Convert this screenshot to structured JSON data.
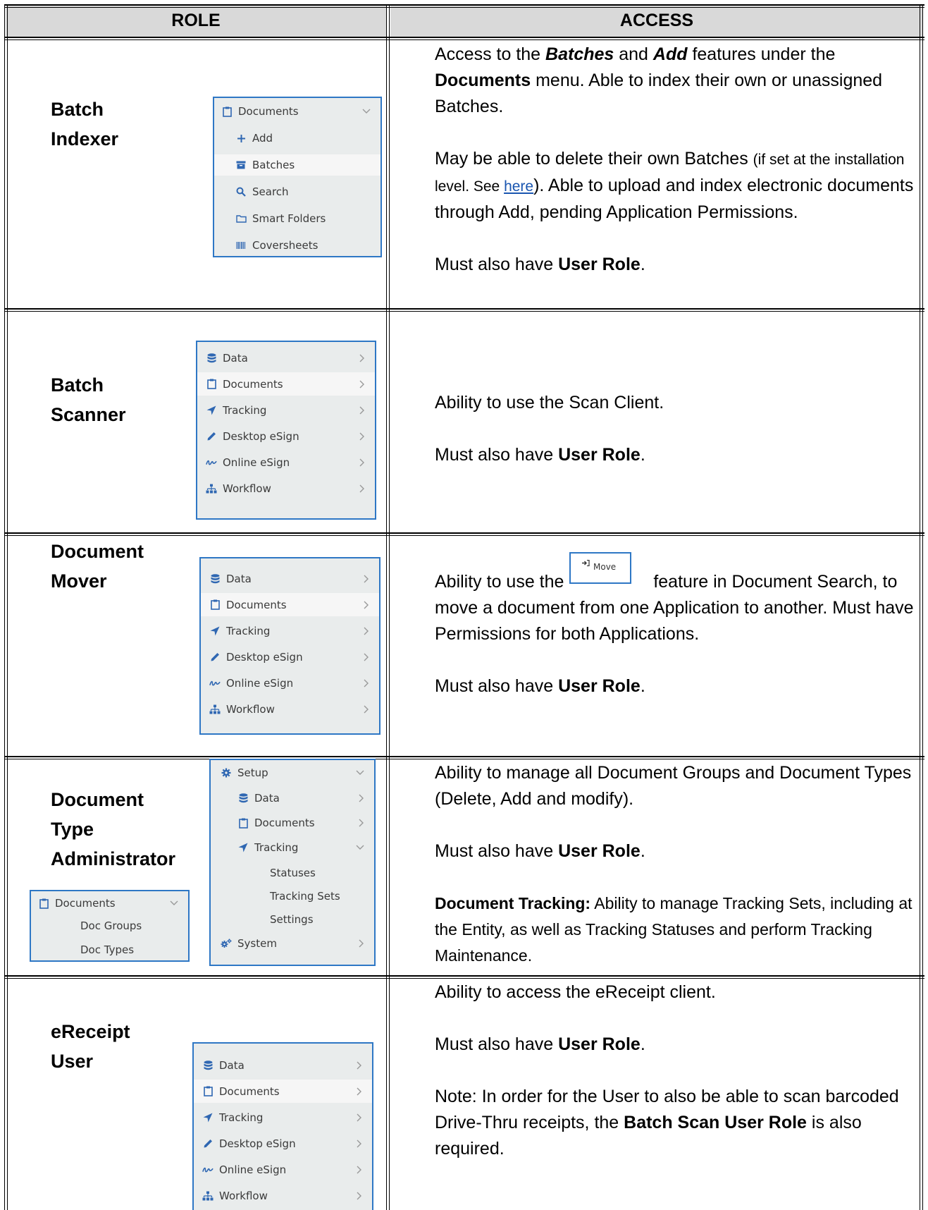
{
  "header": {
    "role": "ROLE",
    "access": "ACCESS"
  },
  "rows": [
    {
      "role_line1": "Batch",
      "role_line2": "Indexer",
      "menu": {
        "title": "Documents",
        "items": [
          "Add",
          "Batches",
          "Search",
          "Smart Folders",
          "Coversheets"
        ]
      },
      "access": {
        "p1_a": "Access to the ",
        "p1_b": "Batches",
        "p1_c": " and ",
        "p1_d": "Add",
        "p1_e": " features under the ",
        "p1_f": "Documents",
        "p1_g": " menu.  Able to index their own or unassigned Batches.",
        "p2_a": " May be able to delete their own Batches ",
        "p2_b": "(if set at the installation level.  See ",
        "p2_link": "here",
        "p2_c": ").  Able to upload and index electronic documents through Add, pending Application Permissions.",
        "p3_a": "Must also have ",
        "p3_b": "User Role",
        "p3_c": "."
      }
    },
    {
      "role_line1": "Batch",
      "role_line2": "Scanner",
      "menu": {
        "items": [
          "Data",
          "Documents",
          "Tracking",
          "Desktop eSign",
          "Online eSign",
          "Workflow"
        ]
      },
      "access": {
        "p1": "Ability to use the Scan Client.",
        "p2_a": "Must also have ",
        "p2_b": "User Role",
        "p2_c": "."
      }
    },
    {
      "role_line1": "Document",
      "role_line2": "Mover",
      "menu": {
        "items": [
          "Data",
          "Documents",
          "Tracking",
          "Desktop eSign",
          "Online eSign",
          "Workflow"
        ]
      },
      "move_button": "Move",
      "access": {
        "p1_a": "Ability to use the ",
        "p1_b": " feature in Document Search, to move a document from one Application to another.  Must have Permissions for both Applications.",
        "p2_a": "Must also have ",
        "p2_b": "User Role",
        "p2_c": "."
      }
    },
    {
      "role_line1": "Document",
      "role_line2": "Type",
      "role_line3": "Administrator",
      "menu_left": {
        "title": "Documents",
        "items": [
          "Doc Groups",
          "Doc Types"
        ]
      },
      "menu_right": {
        "items": [
          "Setup",
          "Data",
          "Documents",
          "Tracking",
          "Statuses",
          "Tracking Sets",
          "Settings",
          "System"
        ]
      },
      "access": {
        "p1": "Ability to manage all Document Groups and Document Types (Delete, Add and modify).",
        "p2_a": "Must also have ",
        "p2_b": "User Role",
        "p2_c": ".",
        "p3_a": "Document Tracking:",
        "p3_b": "  Ability to manage Tracking Sets, including at the Entity, as well as Tracking Statuses and perform Tracking Maintenance."
      }
    },
    {
      "role_line1": "eReceipt",
      "role_line2": "User",
      "menu": {
        "items": [
          "Data",
          "Documents",
          "Tracking",
          "Desktop eSign",
          "Online eSign",
          "Workflow"
        ]
      },
      "access": {
        "p1": "Ability to access the eReceipt client.",
        "p2_a": "Must also have ",
        "p2_b": "User Role",
        "p2_c": ".",
        "p3_a": "Note:  In order for the User to also be able to scan barcoded Drive-Thru receipts, the ",
        "p3_b": "Batch Scan User Role",
        "p3_c": " is also required."
      }
    }
  ]
}
